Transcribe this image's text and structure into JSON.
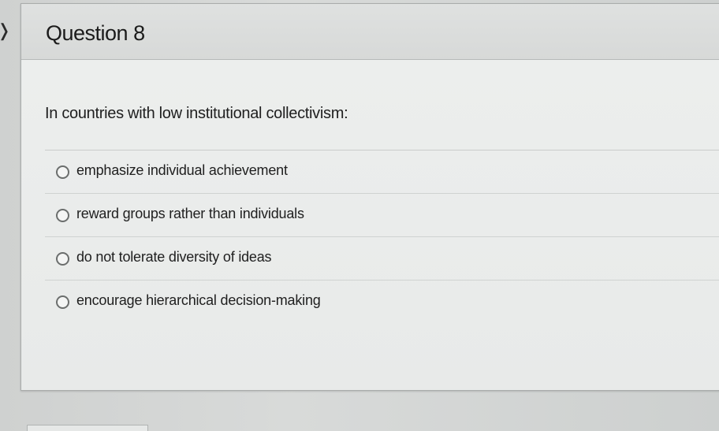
{
  "question": {
    "title": "Question 8",
    "text": "In countries with low institutional collectivism:",
    "options": [
      {
        "label": "emphasize individual achievement",
        "selected": false
      },
      {
        "label": "reward groups rather than individuals",
        "selected": false
      },
      {
        "label": "do not tolerate diversity of ideas",
        "selected": false
      },
      {
        "label": "encourage hierarchical decision-making",
        "selected": false
      }
    ]
  }
}
